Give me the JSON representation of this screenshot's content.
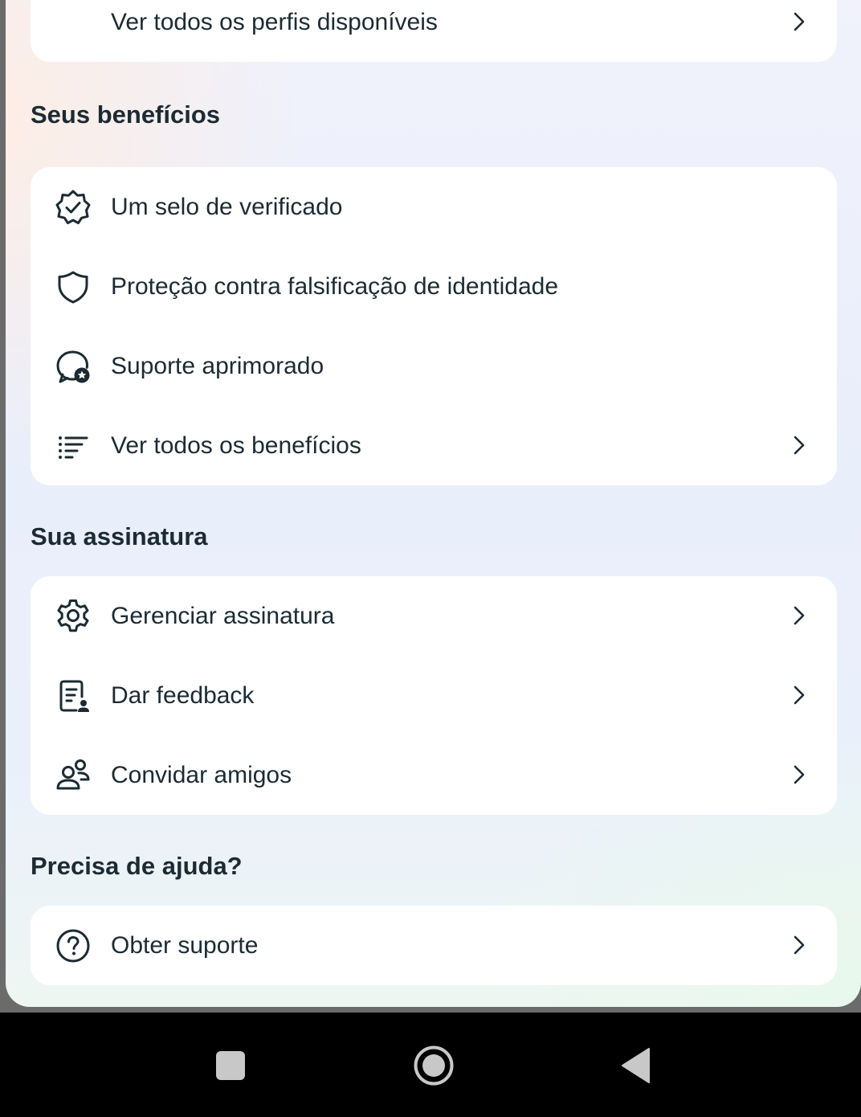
{
  "top_card": {
    "item": {
      "label": "Ver todos os perfis disponíveis",
      "chevron_icon": "chevron-right-icon"
    }
  },
  "benefits": {
    "title": "Seus benefícios",
    "items": [
      {
        "label": "Um selo de verificado",
        "icon": "verified-badge-icon"
      },
      {
        "label": "Proteção contra falsificação de identidade",
        "icon": "shield-icon"
      },
      {
        "label": "Suporte aprimorado",
        "icon": "support-chat-icon"
      },
      {
        "label": "Ver todos os benefícios",
        "icon": "list-icon",
        "chevron_icon": "chevron-right-icon"
      }
    ]
  },
  "subscription": {
    "title": "Sua assinatura",
    "items": [
      {
        "label": "Gerenciar assinatura",
        "icon": "gear-icon",
        "chevron_icon": "chevron-right-icon"
      },
      {
        "label": "Dar feedback",
        "icon": "feedback-icon",
        "chevron_icon": "chevron-right-icon"
      },
      {
        "label": "Convidar amigos",
        "icon": "people-icon",
        "chevron_icon": "chevron-right-icon"
      }
    ]
  },
  "help": {
    "title": "Precisa de ajuda?",
    "items": [
      {
        "label": "Obter suporte",
        "icon": "question-circle-icon",
        "chevron_icon": "chevron-right-icon"
      }
    ]
  },
  "system_nav": {
    "buttons": [
      "recent-apps-icon",
      "home-icon",
      "back-icon"
    ]
  },
  "colors": {
    "text": "#1c2b33",
    "card": "#ffffff",
    "nav_bar": "#000000",
    "nav_icons": "#c8c8c8"
  }
}
